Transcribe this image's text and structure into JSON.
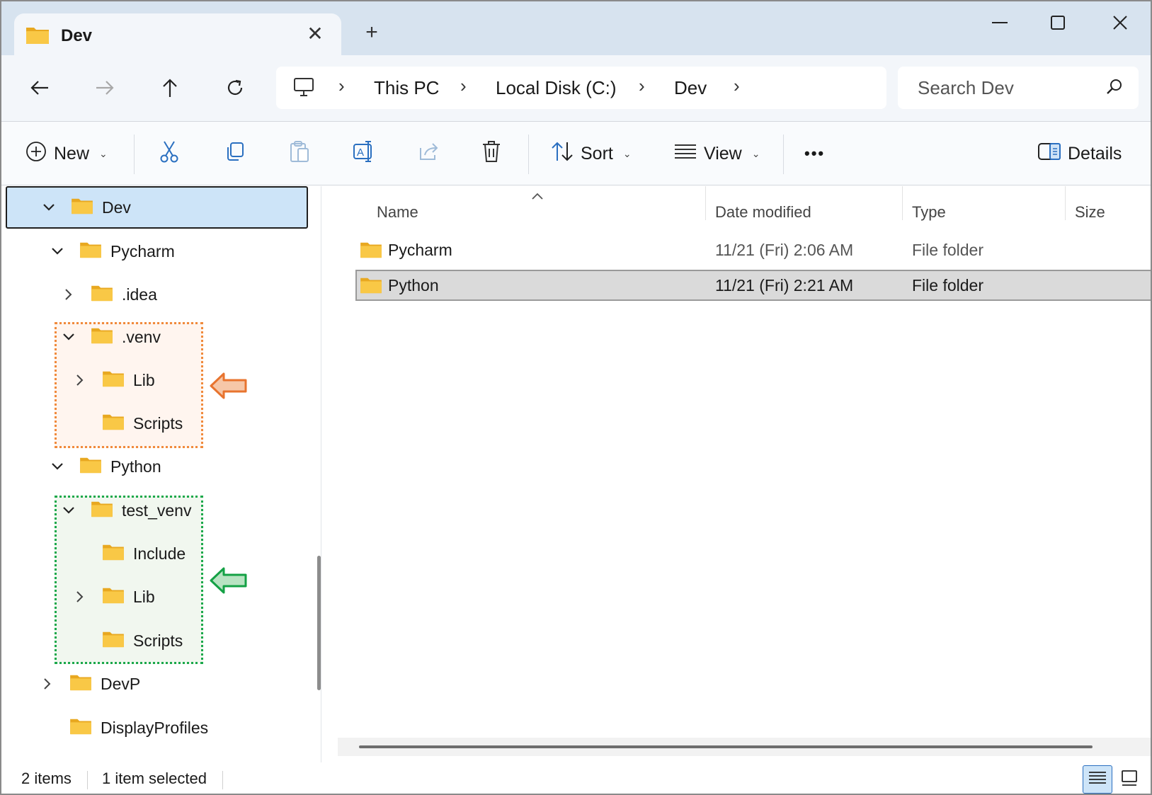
{
  "tab": {
    "title": "Dev",
    "icon": "folder-icon"
  },
  "toolbar_nav": {
    "back": "back-arrow-icon",
    "forward": "forward-arrow-icon",
    "up": "up-arrow-icon",
    "refresh": "refresh-icon"
  },
  "breadcrumb": {
    "items": [
      "This PC",
      "Local Disk (C:)",
      "Dev"
    ]
  },
  "search": {
    "placeholder": "Search Dev"
  },
  "commands": {
    "new_label": "New",
    "sort_label": "Sort",
    "view_label": "View",
    "more_label": "•••",
    "details_label": "Details"
  },
  "nav_tree": [
    {
      "label": "Dev",
      "expanded": true,
      "selected": true
    },
    {
      "label": "Pycharm",
      "expanded": true
    },
    {
      "label": ".idea",
      "expanded": false
    },
    {
      "label": ".venv",
      "expanded": true
    },
    {
      "label": "Lib",
      "expanded": false
    },
    {
      "label": "Scripts"
    },
    {
      "label": "Python",
      "expanded": true
    },
    {
      "label": "test_venv",
      "expanded": true
    },
    {
      "label": "Include"
    },
    {
      "label": "Lib",
      "expanded": false
    },
    {
      "label": "Scripts"
    },
    {
      "label": "DevP",
      "expanded": false
    },
    {
      "label": "DisplayProfiles"
    }
  ],
  "columns": {
    "name": "Name",
    "date": "Date modified",
    "type": "Type",
    "size": "Size"
  },
  "files": [
    {
      "name": "Pycharm",
      "date": "11/21 (Fri) 2:06 AM",
      "type": "File folder",
      "selected": false
    },
    {
      "name": "Python",
      "date": "11/21 (Fri) 2:21 AM",
      "type": "File folder",
      "selected": true
    }
  ],
  "status": {
    "items": "2 items",
    "selected": "1 item selected"
  },
  "colors": {
    "folder": "#f6c443",
    "selection": "#cde4f8",
    "venv_box": "#f08a3c",
    "test_venv_box": "#1aa84a"
  }
}
